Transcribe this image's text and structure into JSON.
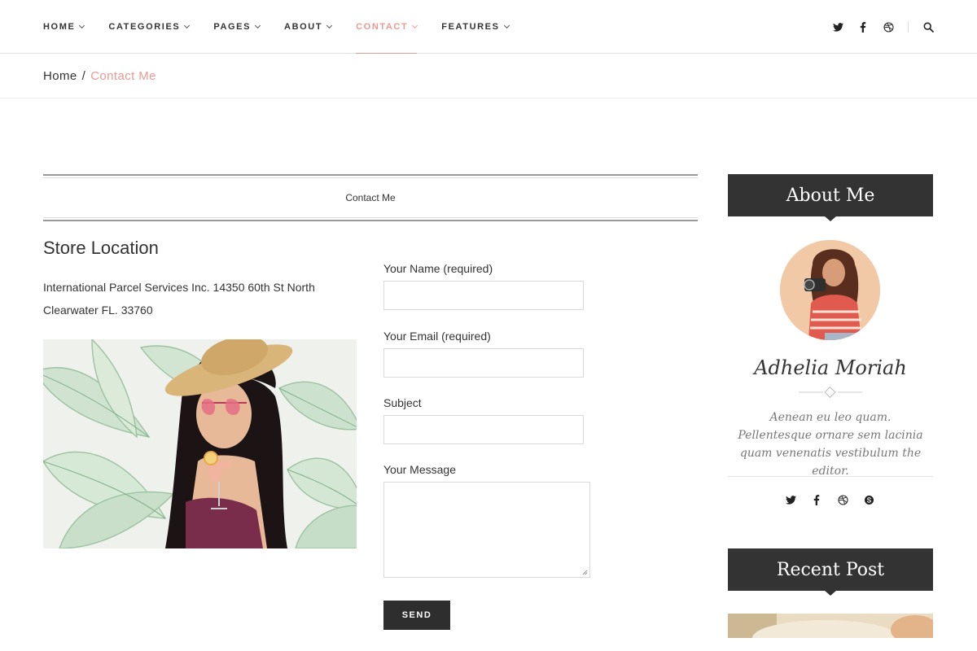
{
  "nav": {
    "items": [
      {
        "label": "HOME",
        "active": false
      },
      {
        "label": "CATEGORIES",
        "active": false
      },
      {
        "label": "PAGES",
        "active": false
      },
      {
        "label": "ABOUT",
        "active": false
      },
      {
        "label": "CONTACT",
        "active": true
      },
      {
        "label": "FEATURES",
        "active": false
      }
    ],
    "icons": [
      "twitter-icon",
      "facebook-icon",
      "dribbble-icon",
      "search-icon"
    ]
  },
  "breadcrumb": {
    "home": "Home",
    "separator": "/",
    "current": "Contact Me"
  },
  "section": {
    "title": "Contact Me"
  },
  "store": {
    "title": "Store Location",
    "address_line1": "International Parcel Services Inc. 14350 60th St North",
    "address_line2": "Clearwater FL. 33760"
  },
  "form": {
    "name_label": "Your Name (required)",
    "name_value": "",
    "email_label": "Your Email (required)",
    "email_value": "",
    "subject_label": "Subject",
    "subject_value": "",
    "message_label": "Your Message",
    "message_value": "",
    "send_label": "SEND"
  },
  "sidebar": {
    "about_title": "About Me",
    "author_name": "Adhelia Moriah",
    "author_bio": "Aenean eu leo quam. Pellentesque ornare sem lacinia quam venenatis vestibulum the editor.",
    "social_icons": [
      "twitter-icon",
      "facebook-icon",
      "dribbble-icon",
      "skype-icon"
    ],
    "recent_title": "Recent Post"
  },
  "colors": {
    "accent": "#e89b92",
    "dark": "#333333",
    "text": "#333333",
    "muted": "#777777"
  }
}
